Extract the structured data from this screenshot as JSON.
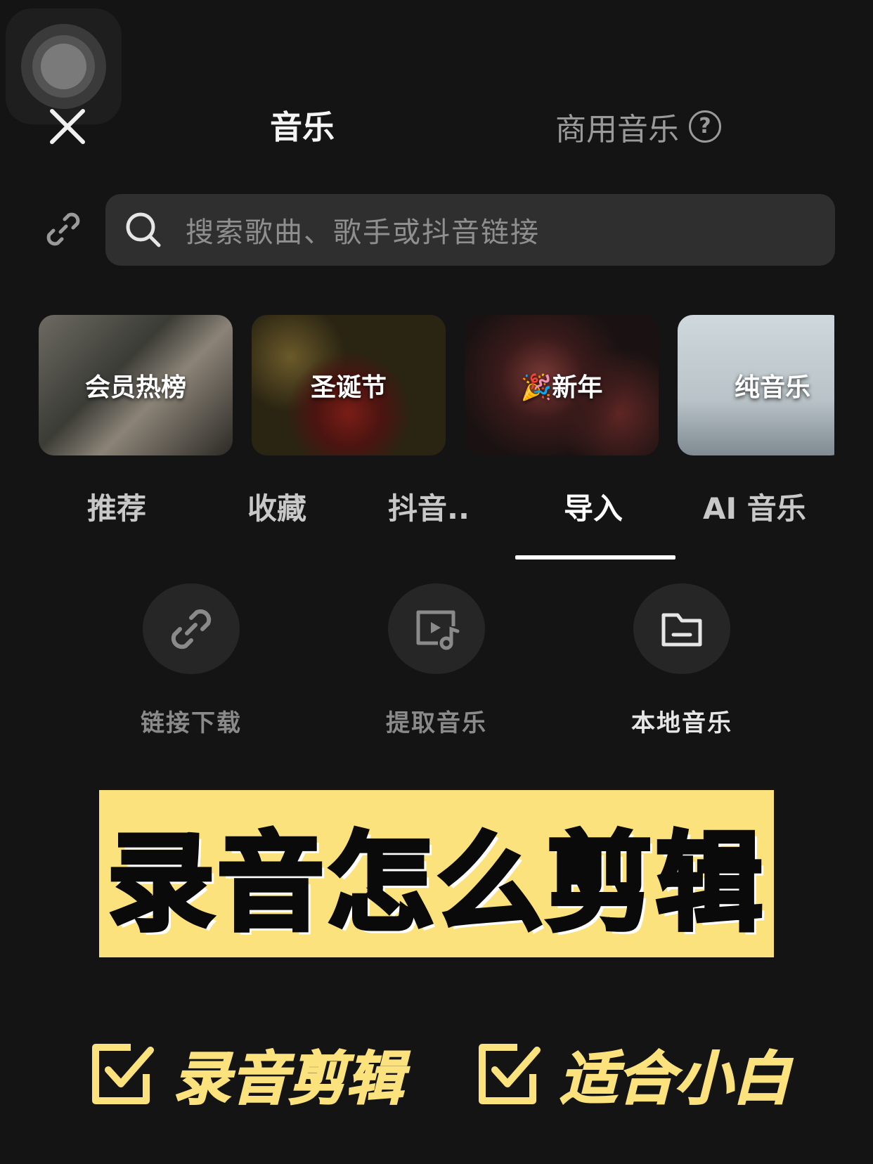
{
  "header": {
    "title": "音乐",
    "commercial_label": "商用音乐",
    "help_symbol": "?"
  },
  "search": {
    "placeholder": "搜索歌曲、歌手或抖音链接"
  },
  "categories": [
    {
      "label": "会员热榜"
    },
    {
      "label": "圣诞节"
    },
    {
      "label": "🎉新年"
    },
    {
      "label": "纯音乐"
    }
  ],
  "tabs": [
    {
      "label": "推荐"
    },
    {
      "label": "收藏"
    },
    {
      "label": "抖音.."
    },
    {
      "label": "导入",
      "active": true
    },
    {
      "label": "AI 音乐"
    }
  ],
  "actions": [
    {
      "label": "链接下载",
      "icon": "link-icon"
    },
    {
      "label": "提取音乐",
      "icon": "video-music-icon"
    },
    {
      "label": "本地音乐",
      "icon": "folder-icon"
    }
  ],
  "overlay": {
    "banner_text": "录音怎么剪辑",
    "tag1": "录音剪辑",
    "tag2": "适合小白",
    "accent_color": "#fbe27d"
  }
}
